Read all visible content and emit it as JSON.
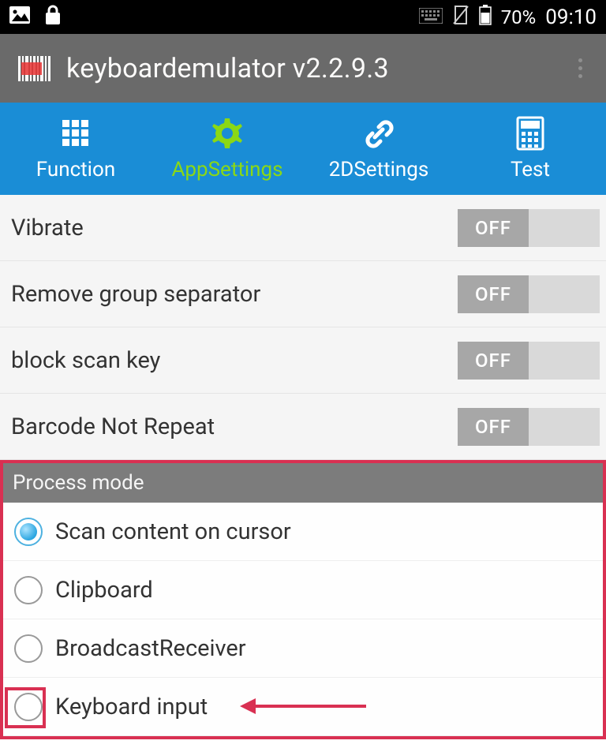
{
  "status": {
    "battery_pct": "70%",
    "time": "09:10"
  },
  "app": {
    "title": "keyboardemulator v2.2.9.3"
  },
  "tabs": [
    {
      "label": "Function",
      "active": false
    },
    {
      "label": "AppSettings",
      "active": true
    },
    {
      "label": "2DSettings",
      "active": false
    },
    {
      "label": "Test",
      "active": false
    }
  ],
  "settings": [
    {
      "label": "Vibrate",
      "state": "OFF"
    },
    {
      "label": "Remove group separator",
      "state": "OFF"
    },
    {
      "label": "block scan key",
      "state": "OFF"
    },
    {
      "label": "Barcode Not Repeat",
      "state": "OFF"
    }
  ],
  "section": {
    "title": "Process mode",
    "options": [
      {
        "label": "Scan content on cursor",
        "selected": true
      },
      {
        "label": "Clipboard",
        "selected": false
      },
      {
        "label": "BroadcastReceiver",
        "selected": false
      },
      {
        "label": "Keyboard input",
        "selected": false
      }
    ]
  }
}
